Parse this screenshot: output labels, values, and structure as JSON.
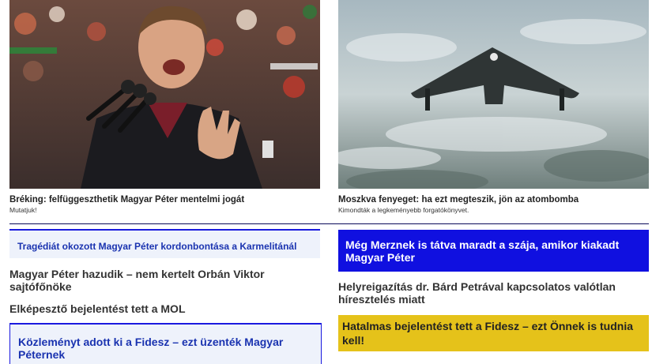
{
  "cards": [
    {
      "title": "Bréking: felfüggeszthetik Magyar Péter mentelmi jogát",
      "subtitle": "Mutatjuk!"
    },
    {
      "title": "Moszkva fenyeget: ha ezt megteszik, jön az atombomba",
      "subtitle": "Kimondták a legkeményebb forgatókönyvet."
    }
  ],
  "left_list": {
    "highlight_1": "Tragédiát okozott Magyar Péter kordonbontása a Karmelitánál",
    "headline_1": "Magyar Péter hazudik – nem kertelt Orbán Viktor sajtófőnöke",
    "headline_2": "Elképesztő bejelentést tett a MOL",
    "highlight_2": "Közleményt adott ki a Fidesz – ezt üzenték Magyar Péternek"
  },
  "right_list": {
    "blue_box": "Még Merznek is tátva maradt a szája, amikor kiakadt Magyar Péter",
    "headline_1": "Helyreigazítás dr. Bárd Petrával kapcsolatos valótlan híresztelés miatt",
    "yellow_box": "Hatalmas bejelentést tett a Fidesz – ezt Önnek is tudnia kell!"
  },
  "colors": {
    "accent_blue": "#1010e0",
    "highlight_yellow": "#e5c21a",
    "rule_dark": "#0a0a5a"
  }
}
